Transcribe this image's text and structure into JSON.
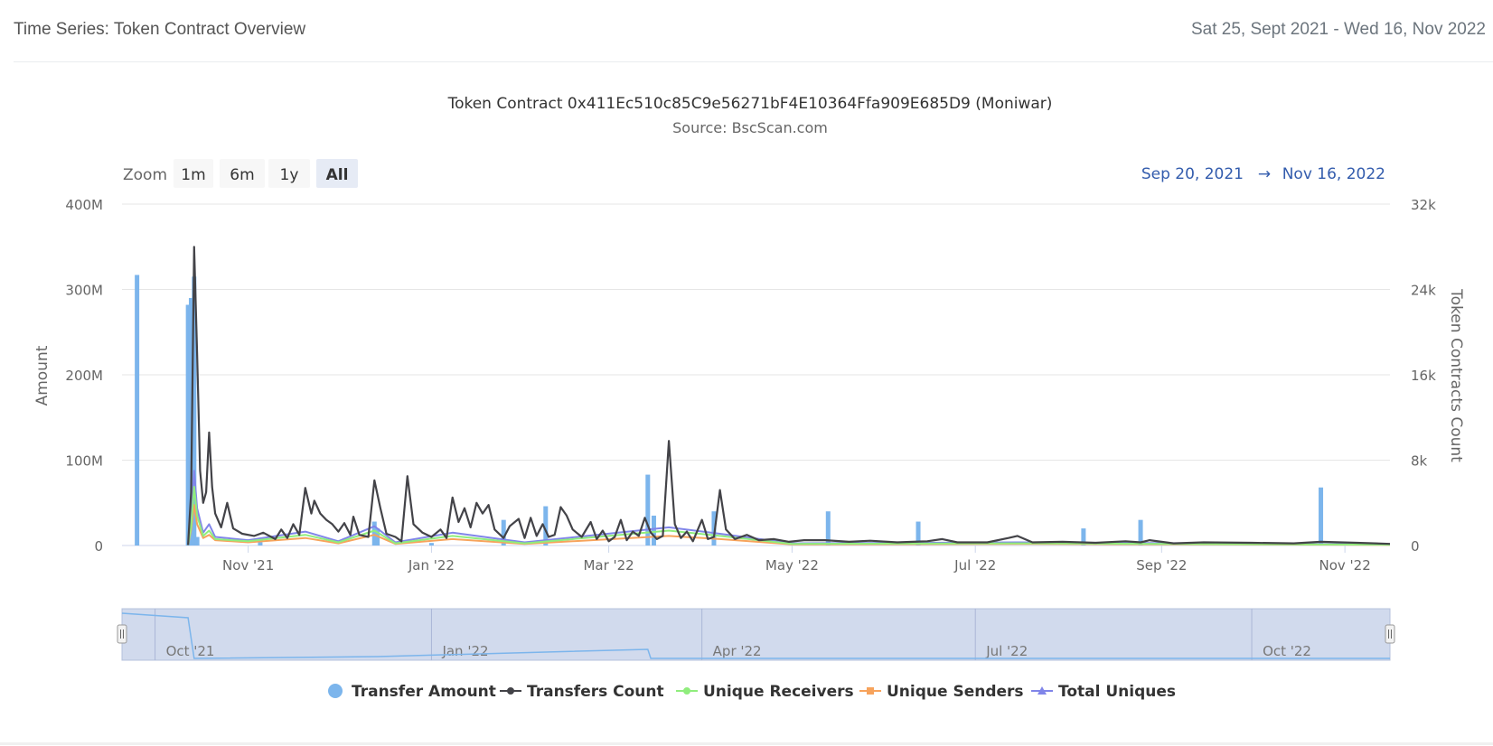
{
  "header": {
    "title": "Time Series: Token Contract Overview",
    "date_range": "Sat 25, Sept 2021 - Wed 16, Nov 2022"
  },
  "range_selector": {
    "zoom_label": "Zoom",
    "buttons": [
      "1m",
      "6m",
      "1y",
      "All"
    ],
    "selected": "All",
    "from": "Sep 20, 2021",
    "arrow": "→",
    "to": "Nov 16, 2022"
  },
  "navigator": {
    "labels": [
      "Oct '21",
      "Jan '22",
      "Apr '22",
      "Jul '22",
      "Oct '22"
    ]
  },
  "colors": {
    "transfer_amount": "#7cb5ec",
    "transfers_count": "#434348",
    "unique_receivers": "#90ed7d",
    "unique_senders": "#f7a35c",
    "total_uniques": "#8085e9",
    "navigator_fill": "#c9d3ea"
  },
  "chart_data": {
    "type": "bar",
    "title": "Token Contract 0x411Ec510c85C9e56271bF4E10364Ffa909E685D9 (Moniwar)",
    "subtitle": "Source: BscScan.com",
    "x_range": [
      "2021-09-20",
      "2022-11-16"
    ],
    "x_ticks": [
      {
        "date": "2021-11-01",
        "label": "Nov '21"
      },
      {
        "date": "2022-01-01",
        "label": "Jan '22"
      },
      {
        "date": "2022-03-01",
        "label": "Mar '22"
      },
      {
        "date": "2022-05-01",
        "label": "May '22"
      },
      {
        "date": "2022-07-01",
        "label": "Jul '22"
      },
      {
        "date": "2022-09-01",
        "label": "Sep '22"
      },
      {
        "date": "2022-11-01",
        "label": "Nov '22"
      }
    ],
    "y_left": {
      "label": "Amount",
      "ylim": [
        0,
        400000000
      ],
      "ticks": [
        "0",
        "100M",
        "200M",
        "300M",
        "400M"
      ]
    },
    "y_right": {
      "label": "Token Contracts Count",
      "ylim": [
        0,
        32000
      ],
      "ticks": [
        "0",
        "8k",
        "16k",
        "24k",
        "32k"
      ]
    },
    "grid": true,
    "legend_position": "bottom",
    "series": [
      {
        "name": "Transfer Amount",
        "type": "bar",
        "axis": "left",
        "points": [
          [
            "2021-09-25",
            317000000
          ],
          [
            "2021-10-12",
            282000000
          ],
          [
            "2021-10-13",
            290000000
          ],
          [
            "2021-10-14",
            315000000
          ],
          [
            "2021-10-15",
            10000000
          ],
          [
            "2021-11-05",
            4000000
          ],
          [
            "2021-12-13",
            28000000
          ],
          [
            "2021-12-14",
            20000000
          ],
          [
            "2022-01-01",
            3000000
          ],
          [
            "2022-01-25",
            30000000
          ],
          [
            "2022-02-08",
            46000000
          ],
          [
            "2022-03-14",
            83000000
          ],
          [
            "2022-03-16",
            35000000
          ],
          [
            "2022-04-05",
            40000000
          ],
          [
            "2022-05-13",
            40000000
          ],
          [
            "2022-06-12",
            28000000
          ],
          [
            "2022-08-06",
            20000000
          ],
          [
            "2022-08-25",
            30000000
          ],
          [
            "2022-10-24",
            68000000
          ]
        ]
      },
      {
        "name": "Transfers Count",
        "type": "line",
        "axis": "right",
        "points": [
          [
            "2021-10-12",
            50
          ],
          [
            "2021-10-13",
            5000
          ],
          [
            "2021-10-14",
            28000
          ],
          [
            "2021-10-15",
            18000
          ],
          [
            "2021-10-16",
            7000
          ],
          [
            "2021-10-17",
            4000
          ],
          [
            "2021-10-18",
            5000
          ],
          [
            "2021-10-19",
            10600
          ],
          [
            "2021-10-20",
            5500
          ],
          [
            "2021-10-21",
            3000
          ],
          [
            "2021-10-23",
            1700
          ],
          [
            "2021-10-25",
            4000
          ],
          [
            "2021-10-27",
            1600
          ],
          [
            "2021-10-30",
            1100
          ],
          [
            "2021-11-03",
            900
          ],
          [
            "2021-11-06",
            1200
          ],
          [
            "2021-11-10",
            600
          ],
          [
            "2021-11-12",
            1500
          ],
          [
            "2021-11-14",
            700
          ],
          [
            "2021-11-16",
            2000
          ],
          [
            "2021-11-18",
            1000
          ],
          [
            "2021-11-20",
            5400
          ],
          [
            "2021-11-22",
            3000
          ],
          [
            "2021-11-23",
            4200
          ],
          [
            "2021-11-25",
            3000
          ],
          [
            "2021-11-27",
            2400
          ],
          [
            "2021-11-29",
            2000
          ],
          [
            "2021-12-01",
            1300
          ],
          [
            "2021-12-03",
            2100
          ],
          [
            "2021-12-05",
            1000
          ],
          [
            "2021-12-06",
            2700
          ],
          [
            "2021-12-08",
            1000
          ],
          [
            "2021-12-11",
            800
          ],
          [
            "2021-12-13",
            6100
          ],
          [
            "2021-12-15",
            3500
          ],
          [
            "2021-12-17",
            1100
          ],
          [
            "2021-12-20",
            800
          ],
          [
            "2021-12-22",
            400
          ],
          [
            "2021-12-24",
            6500
          ],
          [
            "2021-12-26",
            2000
          ],
          [
            "2021-12-29",
            1200
          ],
          [
            "2022-01-01",
            800
          ],
          [
            "2022-01-04",
            1500
          ],
          [
            "2022-01-06",
            700
          ],
          [
            "2022-01-08",
            4500
          ],
          [
            "2022-01-10",
            2200
          ],
          [
            "2022-01-12",
            3500
          ],
          [
            "2022-01-14",
            1700
          ],
          [
            "2022-01-16",
            4000
          ],
          [
            "2022-01-18",
            3000
          ],
          [
            "2022-01-20",
            3800
          ],
          [
            "2022-01-22",
            1500
          ],
          [
            "2022-01-25",
            700
          ],
          [
            "2022-01-27",
            1800
          ],
          [
            "2022-01-30",
            2500
          ],
          [
            "2022-02-01",
            700
          ],
          [
            "2022-02-03",
            2600
          ],
          [
            "2022-02-05",
            900
          ],
          [
            "2022-02-07",
            2000
          ],
          [
            "2022-02-09",
            800
          ],
          [
            "2022-02-11",
            1000
          ],
          [
            "2022-02-13",
            3600
          ],
          [
            "2022-02-15",
            2800
          ],
          [
            "2022-02-17",
            1500
          ],
          [
            "2022-02-20",
            800
          ],
          [
            "2022-02-23",
            2200
          ],
          [
            "2022-02-25",
            600
          ],
          [
            "2022-02-27",
            1400
          ],
          [
            "2022-03-01",
            400
          ],
          [
            "2022-03-03",
            800
          ],
          [
            "2022-03-05",
            2400
          ],
          [
            "2022-03-07",
            500
          ],
          [
            "2022-03-09",
            1300
          ],
          [
            "2022-03-11",
            900
          ],
          [
            "2022-03-13",
            2600
          ],
          [
            "2022-03-15",
            1200
          ],
          [
            "2022-03-17",
            600
          ],
          [
            "2022-03-19",
            900
          ],
          [
            "2022-03-21",
            9800
          ],
          [
            "2022-03-23",
            2000
          ],
          [
            "2022-03-25",
            700
          ],
          [
            "2022-03-27",
            1300
          ],
          [
            "2022-03-29",
            400
          ],
          [
            "2022-04-01",
            2400
          ],
          [
            "2022-04-03",
            600
          ],
          [
            "2022-04-05",
            800
          ],
          [
            "2022-04-07",
            5200
          ],
          [
            "2022-04-09",
            1500
          ],
          [
            "2022-04-12",
            600
          ],
          [
            "2022-04-16",
            1000
          ],
          [
            "2022-04-20",
            500
          ],
          [
            "2022-04-25",
            600
          ],
          [
            "2022-04-30",
            350
          ],
          [
            "2022-05-05",
            500
          ],
          [
            "2022-05-12",
            500
          ],
          [
            "2022-05-20",
            350
          ],
          [
            "2022-05-27",
            450
          ],
          [
            "2022-06-05",
            300
          ],
          [
            "2022-06-15",
            400
          ],
          [
            "2022-06-20",
            600
          ],
          [
            "2022-06-25",
            300
          ],
          [
            "2022-07-05",
            300
          ],
          [
            "2022-07-12",
            700
          ],
          [
            "2022-07-15",
            900
          ],
          [
            "2022-07-20",
            300
          ],
          [
            "2022-07-30",
            350
          ],
          [
            "2022-08-10",
            250
          ],
          [
            "2022-08-20",
            400
          ],
          [
            "2022-08-25",
            300
          ],
          [
            "2022-08-28",
            500
          ],
          [
            "2022-09-05",
            200
          ],
          [
            "2022-09-15",
            300
          ],
          [
            "2022-10-01",
            250
          ],
          [
            "2022-10-15",
            200
          ],
          [
            "2022-10-24",
            350
          ],
          [
            "2022-11-05",
            250
          ],
          [
            "2022-11-16",
            150
          ]
        ]
      },
      {
        "name": "Unique Receivers",
        "type": "line",
        "axis": "right",
        "points": [
          [
            "2021-10-12",
            50
          ],
          [
            "2021-10-13",
            1800
          ],
          [
            "2021-10-14",
            5500
          ],
          [
            "2021-10-15",
            2800
          ],
          [
            "2021-10-17",
            900
          ],
          [
            "2021-10-19",
            1400
          ],
          [
            "2021-10-21",
            600
          ],
          [
            "2021-11-01",
            400
          ],
          [
            "2021-11-20",
            1000
          ],
          [
            "2021-12-01",
            300
          ],
          [
            "2021-12-13",
            1400
          ],
          [
            "2021-12-20",
            200
          ],
          [
            "2022-01-08",
            900
          ],
          [
            "2022-02-01",
            200
          ],
          [
            "2022-03-21",
            1400
          ],
          [
            "2022-04-07",
            900
          ],
          [
            "2022-05-01",
            150
          ],
          [
            "2022-07-15",
            200
          ],
          [
            "2022-11-16",
            80
          ]
        ]
      },
      {
        "name": "Unique Senders",
        "type": "line",
        "axis": "right",
        "points": [
          [
            "2021-10-12",
            50
          ],
          [
            "2021-10-13",
            1500
          ],
          [
            "2021-10-14",
            3800
          ],
          [
            "2021-10-15",
            2000
          ],
          [
            "2021-10-17",
            700
          ],
          [
            "2021-10-19",
            1000
          ],
          [
            "2021-10-21",
            500
          ],
          [
            "2021-11-01",
            300
          ],
          [
            "2021-11-20",
            700
          ],
          [
            "2021-12-01",
            200
          ],
          [
            "2021-12-13",
            1000
          ],
          [
            "2021-12-20",
            150
          ],
          [
            "2022-01-08",
            600
          ],
          [
            "2022-02-01",
            150
          ],
          [
            "2022-03-21",
            900
          ],
          [
            "2022-04-07",
            600
          ],
          [
            "2022-05-01",
            100
          ],
          [
            "2022-07-15",
            150
          ],
          [
            "2022-11-16",
            60
          ]
        ]
      },
      {
        "name": "Total Uniques",
        "type": "line",
        "axis": "right",
        "points": [
          [
            "2021-10-12",
            60
          ],
          [
            "2021-10-13",
            2500
          ],
          [
            "2021-10-14",
            7000
          ],
          [
            "2021-10-15",
            3500
          ],
          [
            "2021-10-17",
            1200
          ],
          [
            "2021-10-19",
            2000
          ],
          [
            "2021-10-21",
            800
          ],
          [
            "2021-11-01",
            500
          ],
          [
            "2021-11-20",
            1300
          ],
          [
            "2021-12-01",
            400
          ],
          [
            "2021-12-13",
            1800
          ],
          [
            "2021-12-20",
            300
          ],
          [
            "2022-01-08",
            1200
          ],
          [
            "2022-02-01",
            300
          ],
          [
            "2022-03-21",
            1700
          ],
          [
            "2022-04-07",
            1100
          ],
          [
            "2022-05-01",
            200
          ],
          [
            "2022-07-15",
            300
          ],
          [
            "2022-11-16",
            100
          ]
        ]
      }
    ]
  }
}
